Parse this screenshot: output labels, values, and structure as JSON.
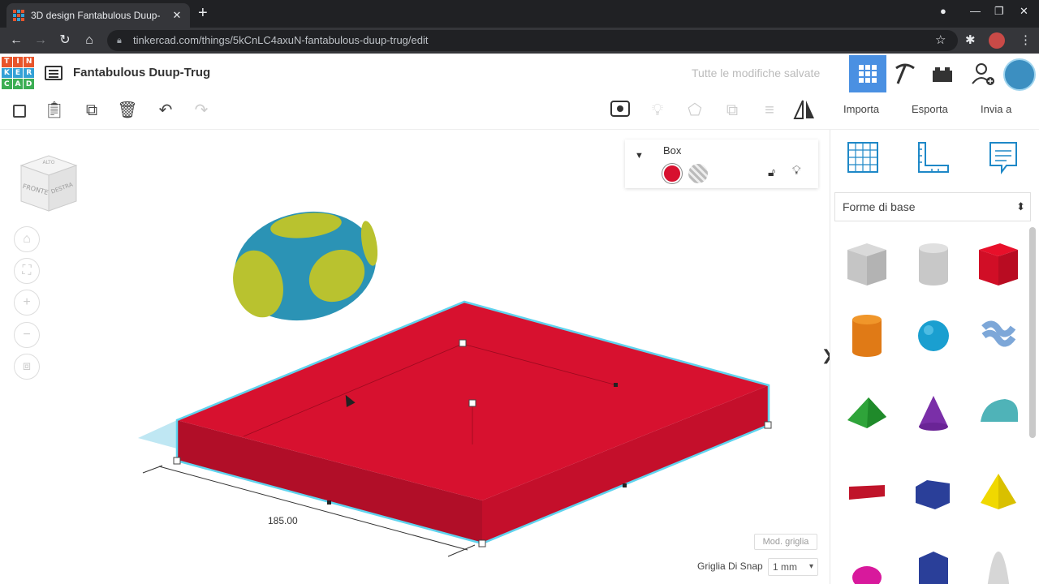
{
  "browser": {
    "tab_title": "3D design Fantabulous Duup-",
    "tab_close": "✕",
    "new_tab": "+",
    "url": "tinkercad.com/things/5kCnLC4axuN-fantabulous-duup-trug/edit"
  },
  "app": {
    "logo_letters": [
      "T",
      "I",
      "N",
      "K",
      "E",
      "R",
      "C",
      "A",
      "D"
    ],
    "design_title": "Fantabulous Duup-Trug",
    "save_status": "Tutte le modifiche salvate"
  },
  "toolbar": {
    "import_label": "Importa",
    "export_label": "Esporta",
    "send_label": "Invia a"
  },
  "viewcube": {
    "front": "FRONTE",
    "right": "DESTRA",
    "top": "ALTO"
  },
  "inspector": {
    "shape_name": "Box",
    "color": "#d7112f"
  },
  "workplane": {
    "dimension_value": "185.00",
    "grid_button": "Mod. griglia",
    "snap_label": "Griglia Di Snap",
    "snap_value": "1 mm"
  },
  "panel": {
    "category": "Forme di base"
  },
  "colors": {
    "box_top": "#d7112f",
    "box_front": "#b10e28",
    "box_side": "#c40f2b",
    "selection_outline": "#5fd3ee",
    "egg_body": "#2b93b5",
    "egg_spots": "#b9c22f",
    "accent_blue": "#4a90e2"
  }
}
